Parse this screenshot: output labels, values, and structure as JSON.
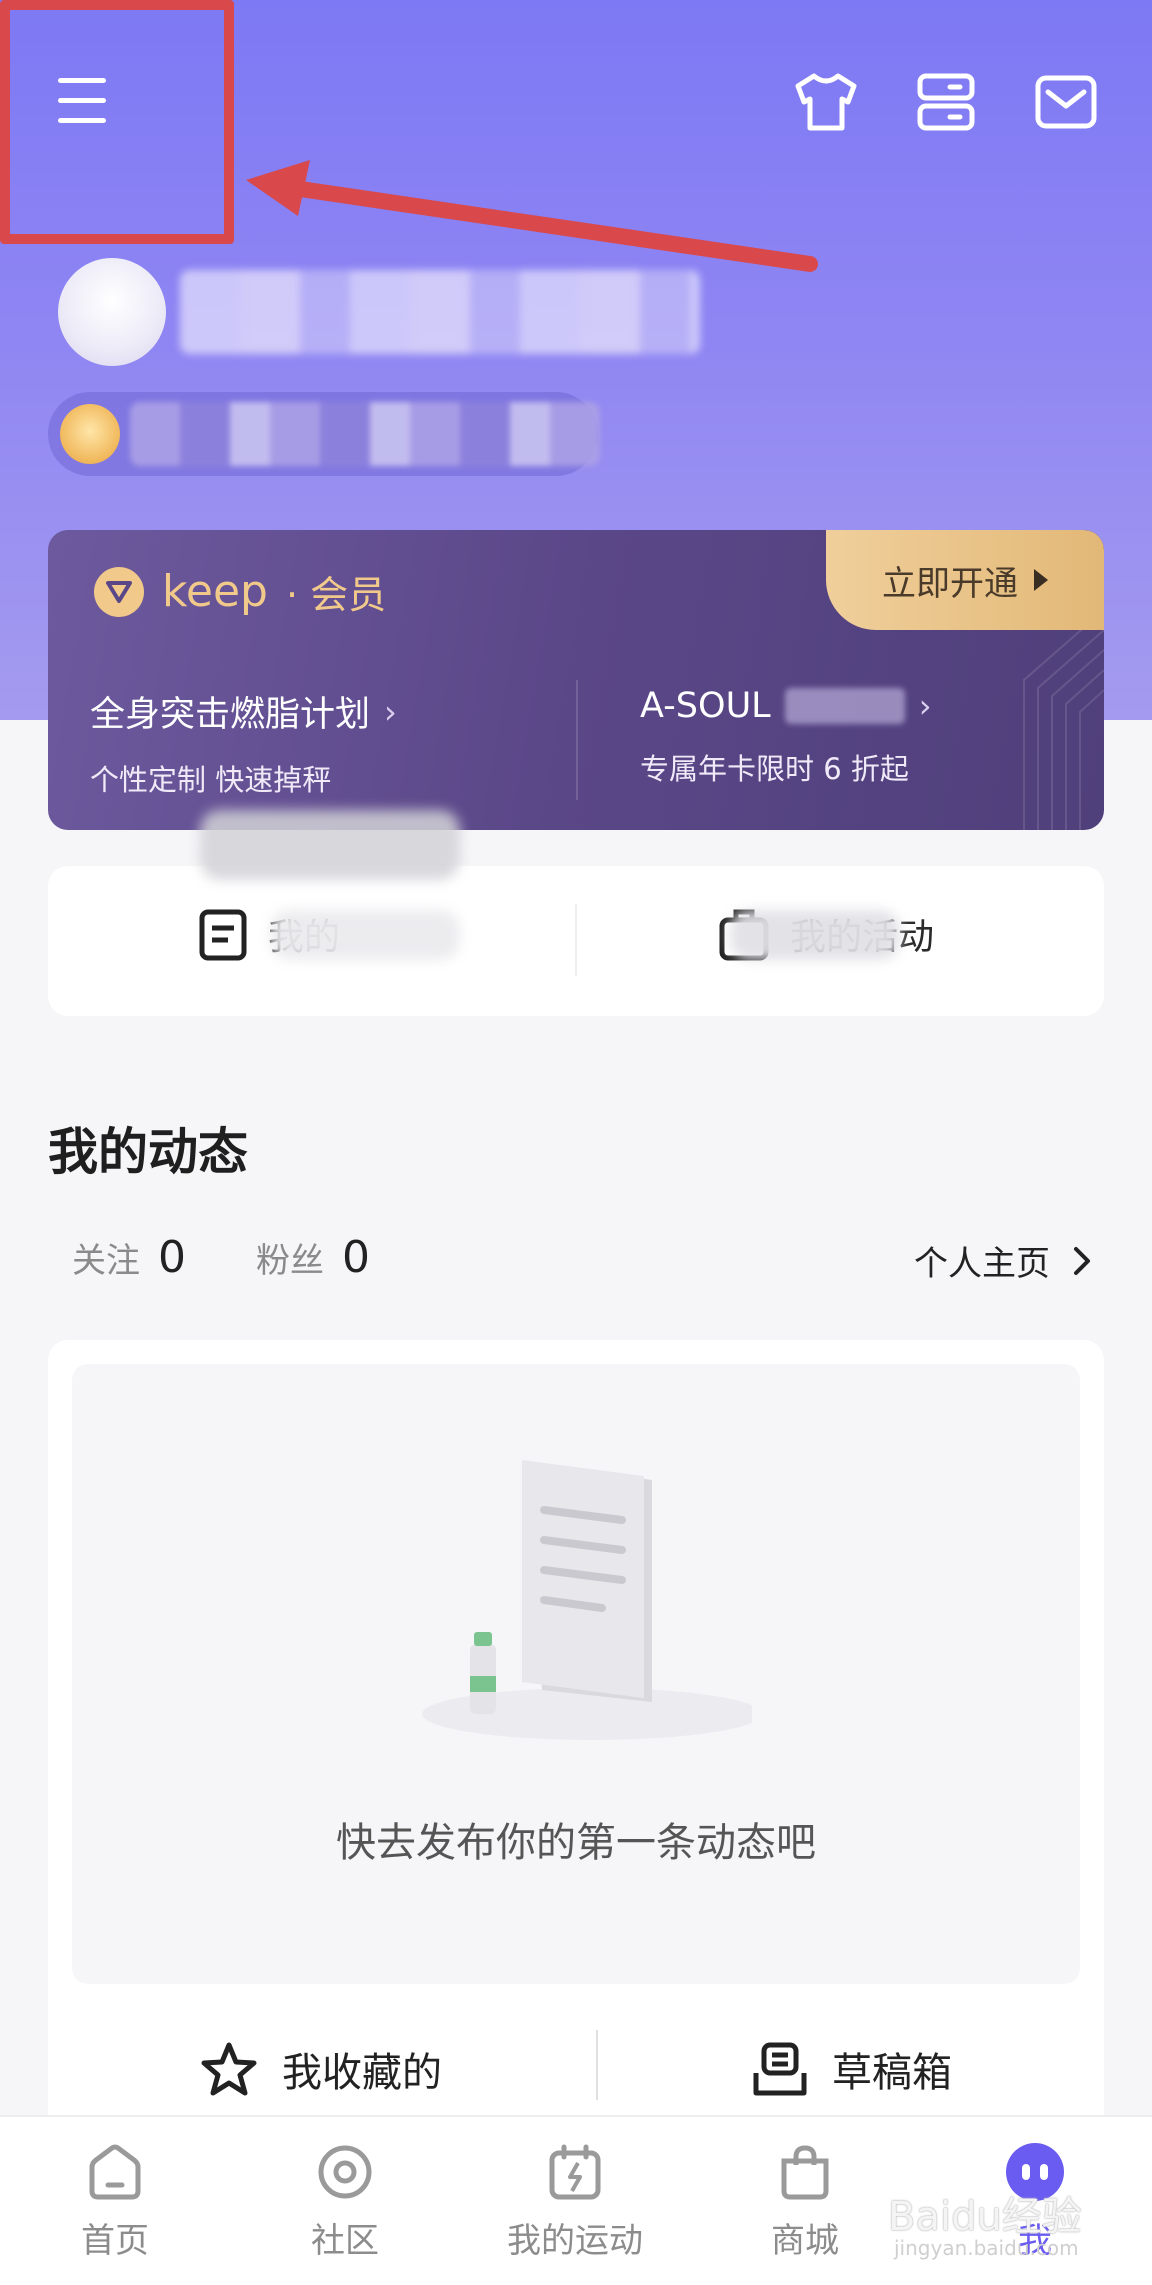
{
  "membership": {
    "brand": "keep",
    "brand_suffix": "· 会员",
    "open_button": "立即开通",
    "left_offer": {
      "title": "全身突击燃脂计划",
      "subtitle": "个性定制 快速掉秤"
    },
    "right_offer": {
      "title": "A-SOUL",
      "subtitle": "专属年卡限时 6 折起"
    }
  },
  "shortcuts": {
    "left_label": "我的",
    "right_label": "我的活动"
  },
  "feed": {
    "title": "我的动态",
    "following_label": "关注",
    "following_count": "0",
    "followers_label": "粉丝",
    "followers_count": "0",
    "profile_link": "个人主页",
    "empty_text": "快去发布你的第一条动态吧",
    "favorites_label": "我收藏的",
    "drafts_label": "草稿箱"
  },
  "nav": {
    "items": [
      {
        "label": "首页",
        "icon": "home-icon"
      },
      {
        "label": "社区",
        "icon": "community-icon"
      },
      {
        "label": "我的运动",
        "icon": "sport-calendar-icon"
      },
      {
        "label": "商城",
        "icon": "shopping-bag-icon"
      },
      {
        "label": "我",
        "icon": "me-icon"
      }
    ]
  },
  "watermark": {
    "text": "Baidu经验",
    "sub": "jingyan.baidu.com"
  },
  "colors": {
    "accent": "#6a5cf0",
    "hero": "#8f85f3",
    "gold": "#f1c98a",
    "annotation_red": "#d9484a"
  }
}
